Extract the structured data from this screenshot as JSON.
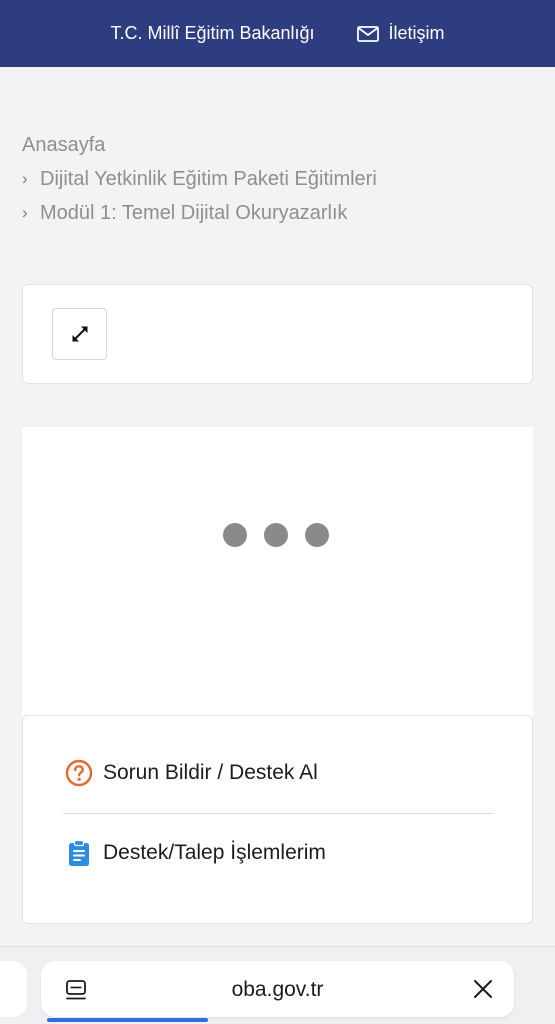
{
  "header": {
    "ministry": "T.C. Millî Eğitim Bakanlığı",
    "contact_label": "İletişim"
  },
  "breadcrumb": {
    "home": "Anasayfa",
    "items": [
      "Dijital Yetkinlik Eğitim Paketi Eğitimleri",
      "Modül 1: Temel Dijital Okuryazarlık"
    ]
  },
  "toolbar": {
    "expand_icon": "expand-arrows-icon"
  },
  "support": {
    "report_label": "Sorun Bildir / Destek Al",
    "requests_label": "Destek/Talep İşlemlerim",
    "colors": {
      "report_icon": "#e8672b",
      "requests_icon": "#2d8ee0"
    }
  },
  "browser": {
    "url": "oba.gov.tr",
    "load_progress": 0.34
  },
  "colors": {
    "header_bg": "#2e3c80",
    "page_bg": "#f3f3f4",
    "loader_dot": "#8a8a8a"
  }
}
